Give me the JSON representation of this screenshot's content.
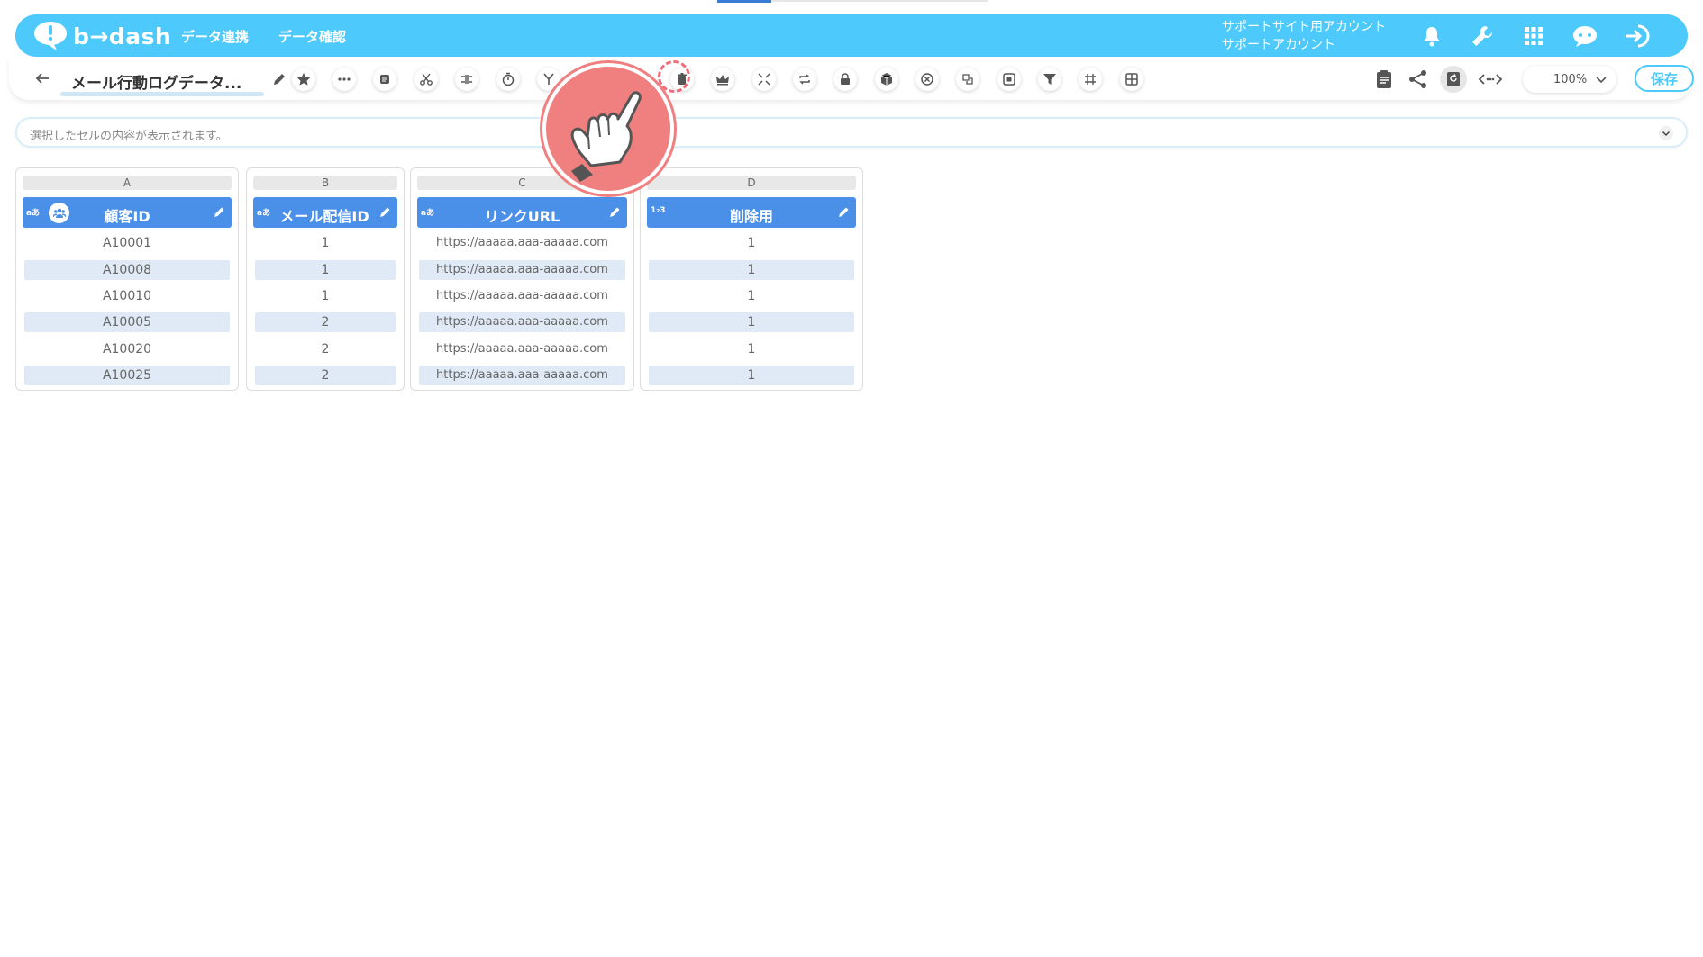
{
  "header": {
    "logo_text": "b→dash",
    "nav": [
      "データ連携",
      "データ確認"
    ],
    "account_line1": "サポートサイト用アカウント",
    "account_line2": "サポートアカウント"
  },
  "toolbar": {
    "title": "メール行動ログデータ...",
    "zoom": "100%",
    "save_label": "保存"
  },
  "cell_bar": {
    "placeholder": "選択したセルの内容が表示されます。"
  },
  "colors": {
    "header_bg": "#4dc9fb",
    "column_header_bg": "#4a8fe8",
    "alt_row_bg": "#dfeaf6",
    "highlight": "#f07f80"
  },
  "columns": [
    {
      "letter": "A",
      "type": "aあ",
      "title": "顧客ID",
      "badge": "people-icon",
      "cells": [
        "A10001",
        "A10008",
        "A10010",
        "A10005",
        "A10020",
        "A10025"
      ]
    },
    {
      "letter": "B",
      "type": "aあ",
      "title": "メール配信ID",
      "cells": [
        "1",
        "1",
        "1",
        "2",
        "2",
        "2"
      ]
    },
    {
      "letter": "C",
      "type": "aあ",
      "title": "リンクURL",
      "cells": [
        "https://aaaaa.aaa-aaaaa.com",
        "https://aaaaa.aaa-aaaaa.com",
        "https://aaaaa.aaa-aaaaa.com",
        "https://aaaaa.aaa-aaaaa.com",
        "https://aaaaa.aaa-aaaaa.com",
        "https://aaaaa.aaa-aaaaa.com"
      ]
    },
    {
      "letter": "D",
      "type": "1₂3",
      "title": "削除用",
      "cells": [
        "1",
        "1",
        "1",
        "1",
        "1",
        "1"
      ]
    }
  ]
}
